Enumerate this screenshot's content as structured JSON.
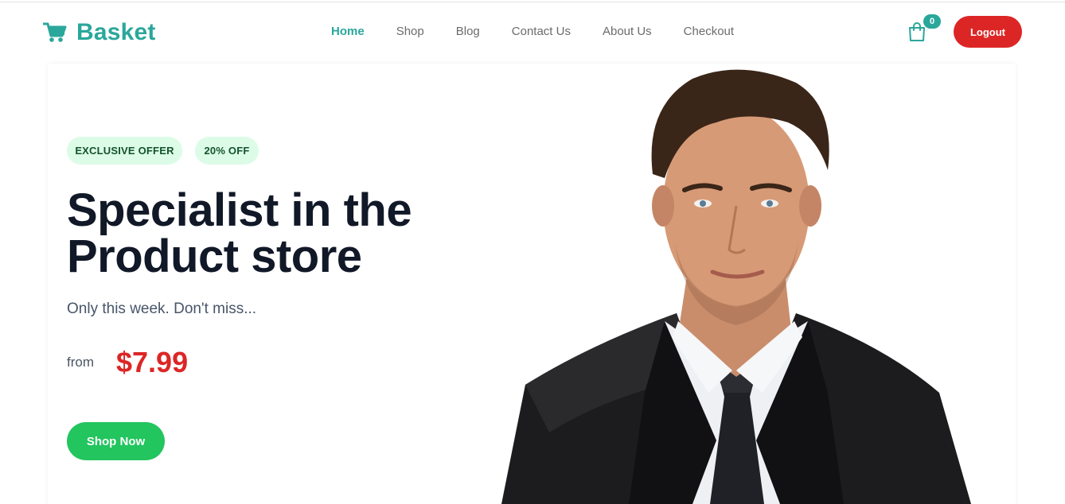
{
  "brand": {
    "name": "Basket",
    "icon": "cart-icon",
    "color": "#2aa79b"
  },
  "nav": {
    "items": [
      {
        "label": "Home",
        "active": true
      },
      {
        "label": "Shop",
        "active": false
      },
      {
        "label": "Blog",
        "active": false
      },
      {
        "label": "Contact Us",
        "active": false
      },
      {
        "label": "About Us",
        "active": false
      },
      {
        "label": "Checkout",
        "active": false
      }
    ]
  },
  "header": {
    "cart_icon": "shopping-bag-icon",
    "cart_count": "0",
    "logout_label": "Logout"
  },
  "hero": {
    "badges": [
      "EXCLUSIVE OFFER",
      "20% OFF"
    ],
    "headline_line1": "Specialist in the",
    "headline_line2": "Product store",
    "subline": "Only this week. Don't miss...",
    "from_label": "from",
    "price": "$7.99",
    "cta_label": "Shop Now",
    "image": "man-in-suit-portrait"
  },
  "colors": {
    "accent": "#2aa79b",
    "danger": "#dc2626",
    "cta": "#22c55e",
    "badge_bg": "#dcfce7",
    "heading": "#111827"
  }
}
